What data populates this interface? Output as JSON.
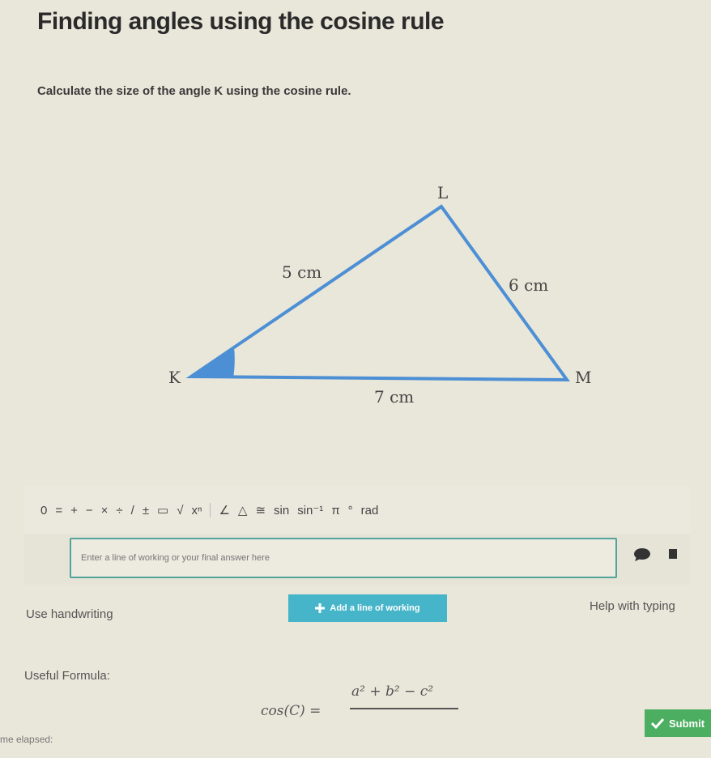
{
  "page": {
    "title": "Finding angles using the cosine rule",
    "question": "Calculate the size of the angle K using the cosine rule."
  },
  "diagram": {
    "vertices": {
      "K": "K",
      "L": "L",
      "M": "M"
    },
    "sides": {
      "KL": "5 cm",
      "LM": "6 cm",
      "KM": "7 cm"
    }
  },
  "toolbar": {
    "zero": "0",
    "equals": "=",
    "plus": "+",
    "minus": "−",
    "times": "×",
    "divide": "÷",
    "slash": "/",
    "plusminus": "±",
    "fraction": "▭",
    "sqrt": "√",
    "power": "xⁿ",
    "angle": "∠",
    "triangle": "△",
    "congruent": "≅",
    "sin": "sin",
    "arcsin": "sin⁻¹",
    "pi": "π",
    "degree": "°",
    "rad": "rad"
  },
  "answer": {
    "placeholder": "Enter a line of working or your final answer here",
    "value": ""
  },
  "controls": {
    "use_handwriting": "Use handwriting",
    "add_line": "Add a line of working",
    "help_typing": "Help with typing",
    "submit": "Submit"
  },
  "formula": {
    "label": "Useful Formula:",
    "lhs": "cos(C) =",
    "numerator": "a² + b² − c²"
  },
  "footer": {
    "time_elapsed": "me elapsed:"
  },
  "colors": {
    "triangle_stroke": "#4d8fd4",
    "angle_fill": "#4d8fd4",
    "input_border": "#52a39a",
    "add_button": "#47b5c9",
    "submit_button": "#4cae60"
  }
}
